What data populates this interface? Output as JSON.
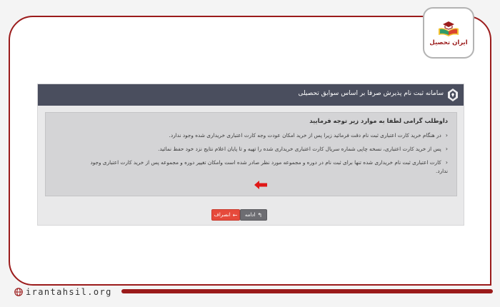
{
  "brand": {
    "name": "ایران تحصیل",
    "accent_color": "#9b1b1b",
    "site_url": "irantahsil.org"
  },
  "app": {
    "header_title": "سامانه ثبت نام پذیرش صرفا بر اساس سوابق تحصیلی",
    "header_bg": "#4a4e5e"
  },
  "notice": {
    "heading": "داوطلب گرامی لطفا به موارد زیر توجه فرمایید",
    "items": [
      "در هنگام خرید کارت اعتباری ثبت نام دقت فرمائید زیرا پس از خرید امکان عودت وجه کارت اعتباری خریداری شده وجود ندارد.",
      "پس از خرید کارت اعتباری، نسخه چاپی شماره سریال کارت اعتباری خریداری شده را تهیه و تا پایان اعلام نتایج نزد خود حفظ نمائید.",
      "کارت اعتباری ثبت نام خریداری شده تنها برای ثبت نام در دوره و مجموعه مورد نظر صادر شده است وامکان تغییر دوره و مجموعه پس از خرید کارت اعتباری وجود",
      "ندارد."
    ]
  },
  "buttons": {
    "continue_label": "ادامه",
    "continue_icon": "reply-arrow-icon",
    "cancel_label": "انصراف",
    "cancel_icon": "arrow-left-icon",
    "cancel_color": "#e64a3b"
  },
  "annotation": {
    "arrow_color": "#e01818"
  }
}
